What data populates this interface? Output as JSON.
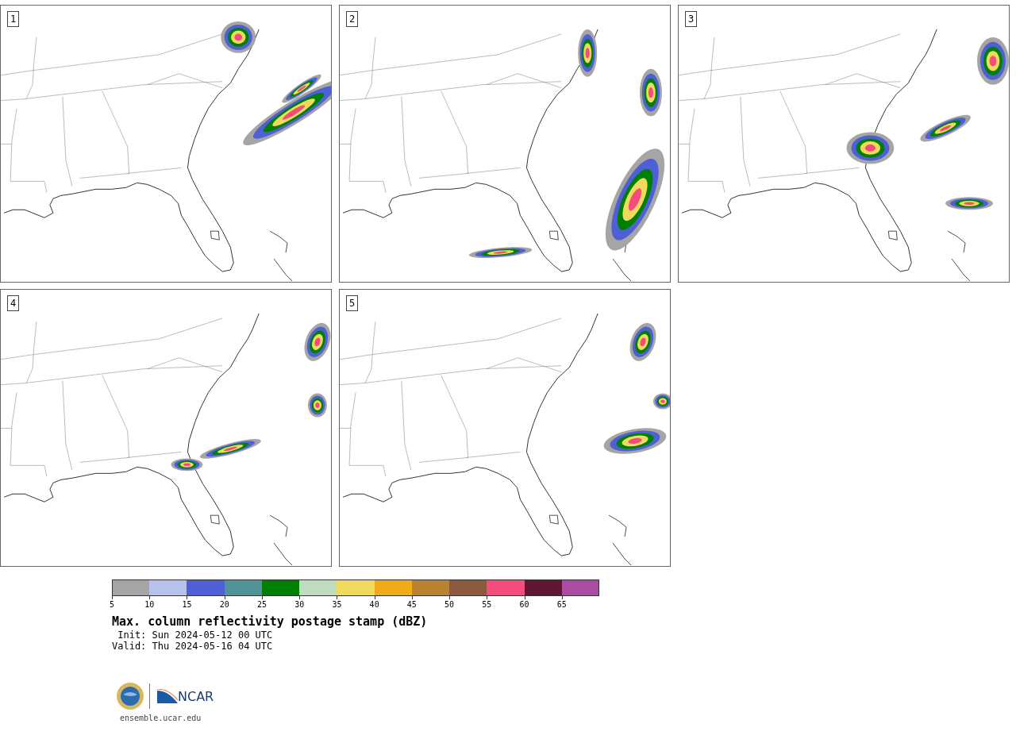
{
  "panels": [
    {
      "label": "1"
    },
    {
      "label": "2"
    },
    {
      "label": "3"
    },
    {
      "label": "4"
    },
    {
      "label": "5"
    }
  ],
  "colorbar": {
    "bins": [
      {
        "color": "#a5a5a5",
        "tick": "5"
      },
      {
        "color": "#b6c1ec",
        "tick": "10"
      },
      {
        "color": "#4f5fd5",
        "tick": "15"
      },
      {
        "color": "#4f9598",
        "tick": "20"
      },
      {
        "color": "#008000",
        "tick": "25"
      },
      {
        "color": "#c0dcbf",
        "tick": "30"
      },
      {
        "color": "#f0da5c",
        "tick": "35"
      },
      {
        "color": "#f0ac18",
        "tick": "40"
      },
      {
        "color": "#bb8232",
        "tick": "45"
      },
      {
        "color": "#8b5a3e",
        "tick": "50"
      },
      {
        "color": "#f44d7d",
        "tick": "55"
      },
      {
        "color": "#5f1734",
        "tick": "60"
      },
      {
        "color": "#ad4ba4",
        "tick": "65"
      }
    ]
  },
  "title": "Max. column reflectivity postage stamp (dBZ)",
  "init": " Init: Sun 2024-05-12 00 UTC",
  "valid": "Valid: Thu 2024-05-16 04 UTC",
  "logo_text": "NCAR",
  "url": "ensemble.ucar.edu"
}
